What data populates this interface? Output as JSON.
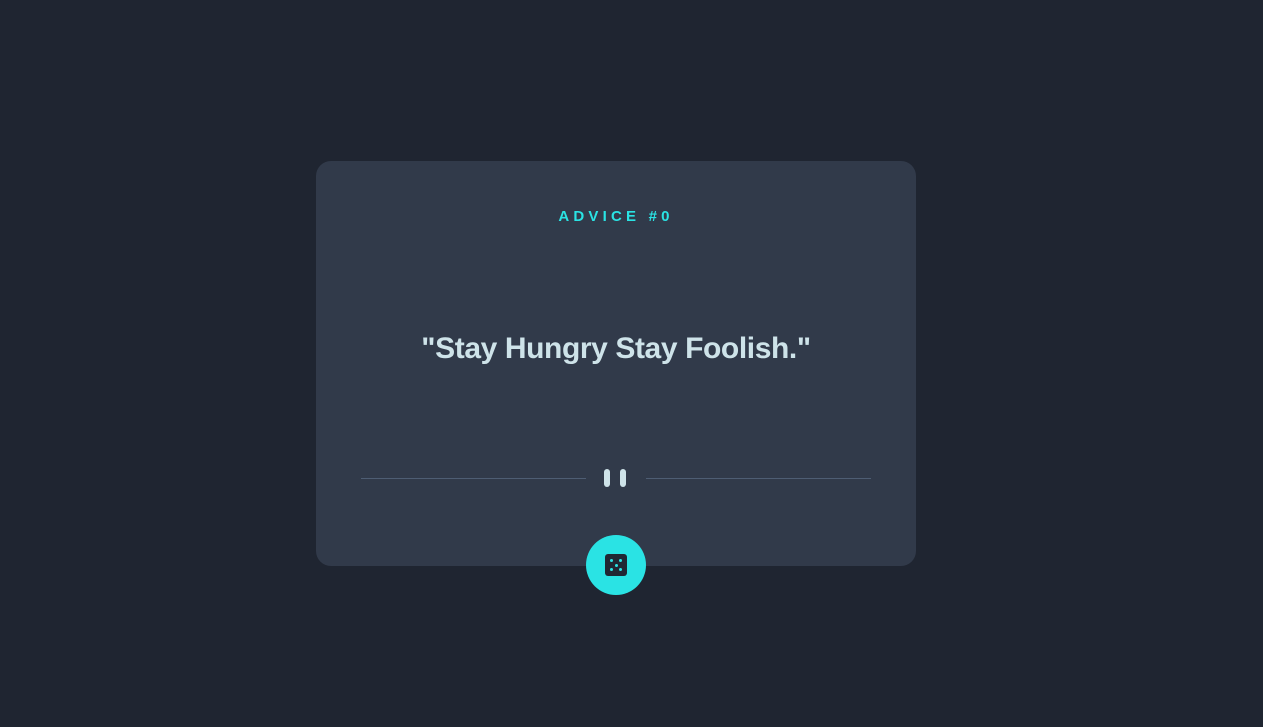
{
  "card": {
    "heading": "ADVICE #0",
    "quote": "\"Stay Hungry Stay Foolish.\""
  },
  "icons": {
    "divider": "pause-icon",
    "button": "dice-icon"
  },
  "colors": {
    "background": "#1f2531",
    "card": "#313a4a",
    "accent": "#2ae3e4",
    "text": "#cee3e9",
    "divider": "#4e5d73"
  }
}
